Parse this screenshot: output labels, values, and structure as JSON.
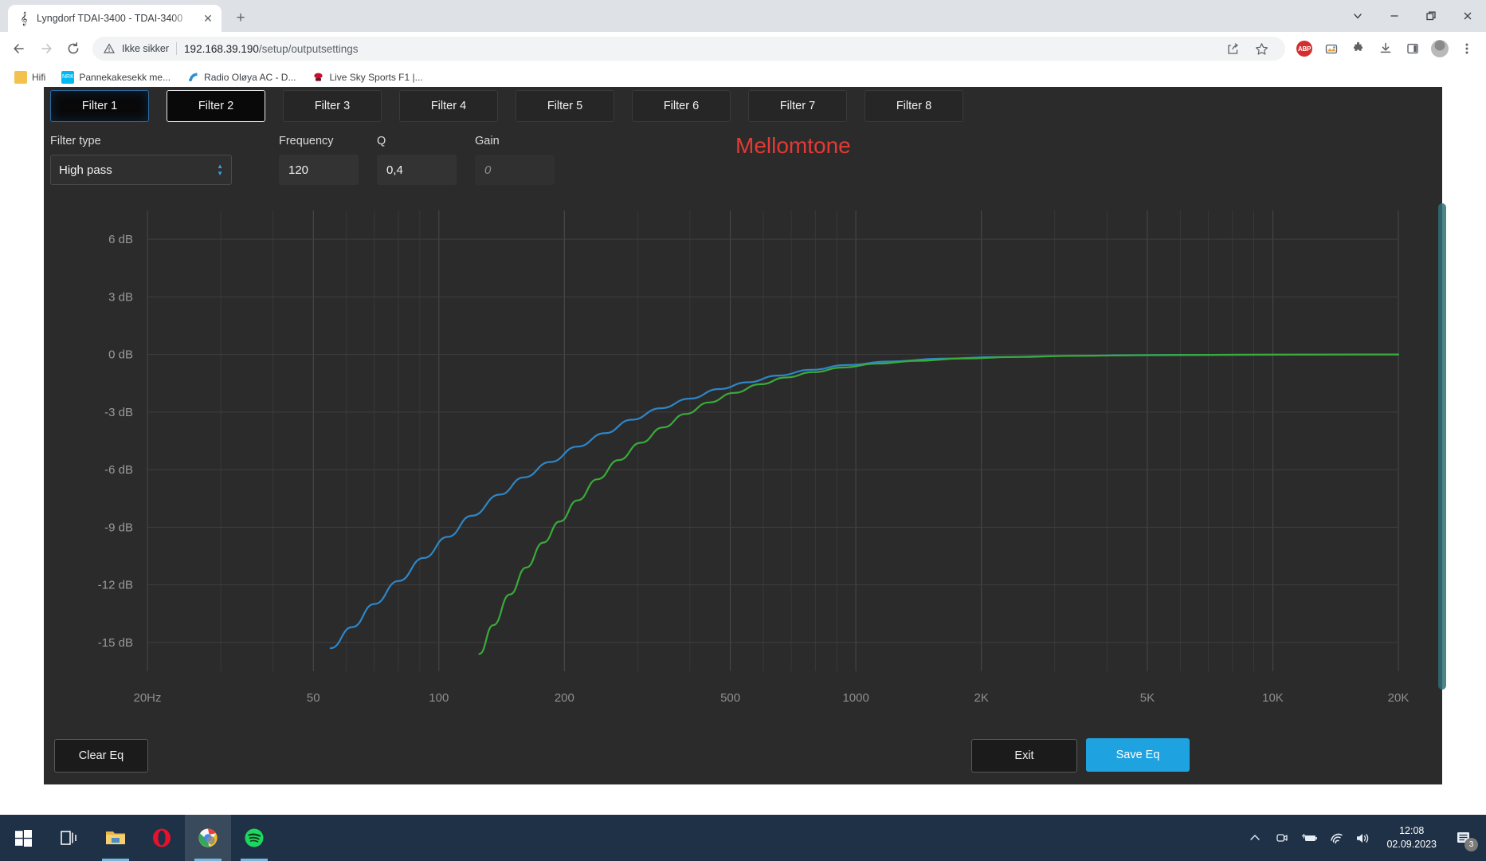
{
  "browser": {
    "tab": {
      "title": "Lyngdorf TDAI-3400 - TDAI-3400",
      "favicon": "music-note-icon",
      "close": "✕"
    },
    "newtab_label": "+",
    "window_controls": {
      "minimize_group": "∨",
      "minimize": "—",
      "restore": "restore-icon",
      "close": "✕"
    },
    "nav": {
      "back": "←",
      "forward": "→",
      "reload": "⟳"
    },
    "omnibox": {
      "warning_icon": "warning-triangle-icon",
      "security_text": "Ikke sikker",
      "host": "192.168.39.190",
      "path": "/setup/outputsettings",
      "share_icon": "share-icon",
      "bookmark_icon": "star-icon"
    },
    "extensions": {
      "adblock_label": "ABP",
      "gallery_icon": "photo-stack-icon",
      "puzzle_icon": "puzzle-icon",
      "download_icon": "download-icon",
      "sidepanel_icon": "side-panel-icon",
      "avatar_icon": "profile-avatar",
      "menu_icon": "three-dot-menu-icon"
    },
    "bookmarks": [
      {
        "label": "Hifi",
        "icon": "folder-icon",
        "color": "#f2c14e"
      },
      {
        "label": "Pannekakesekk me...",
        "icon": "nrk-icon",
        "color": "#00b9f2",
        "text": "NRK"
      },
      {
        "label": "Radio Oløya AC - D...",
        "icon": "rss-icon",
        "color": "#2d8fd5"
      },
      {
        "label": "Live Sky Sports F1 |...",
        "icon": "f1-icon",
        "color": "#c8102e"
      }
    ]
  },
  "app": {
    "filter_tabs": [
      {
        "label": "Filter 1",
        "state": "selected"
      },
      {
        "label": "Filter 2",
        "state": "focused"
      },
      {
        "label": "Filter 3",
        "state": "plain"
      },
      {
        "label": "Filter 4",
        "state": "plain"
      },
      {
        "label": "Filter 5",
        "state": "plain"
      },
      {
        "label": "Filter 6",
        "state": "plain"
      },
      {
        "label": "Filter 7",
        "state": "plain"
      },
      {
        "label": "Filter 8",
        "state": "plain"
      }
    ],
    "controls": {
      "filter_type_label": "Filter type",
      "filter_type_value": "High pass",
      "frequency_label": "Frequency",
      "frequency_value": "120",
      "q_label": "Q",
      "q_value": "0,4",
      "gain_label": "Gain",
      "gain_value": "",
      "gain_placeholder": "0"
    },
    "preset_name": "Mellomtone",
    "preset_color": "#e33a35",
    "buttons": {
      "clear_eq": "Clear Eq",
      "exit": "Exit",
      "save_eq": "Save Eq"
    }
  },
  "chart_data": {
    "type": "line",
    "title": "",
    "xlabel": "",
    "ylabel": "",
    "xscale": "log",
    "xlim": [
      20,
      20000
    ],
    "ylim": [
      -16.5,
      7.5
    ],
    "grid": true,
    "legend": "none",
    "xticks": [
      20,
      50,
      100,
      200,
      500,
      1000,
      2000,
      5000,
      10000,
      20000
    ],
    "xticklabels": [
      "20Hz",
      "50",
      "100",
      "200",
      "500",
      "1000",
      "2K",
      "5K",
      "10K",
      "20K"
    ],
    "yticks": [
      6,
      3,
      0,
      -3,
      -6,
      -9,
      -12,
      -15
    ],
    "yticklabels": [
      "6 dB",
      "3 dB",
      "0 dB",
      "-3 dB",
      "-6 dB",
      "-9 dB",
      "-12 dB",
      "-15 dB"
    ],
    "series": [
      {
        "name": "Filter 1 response",
        "color": "#2e86c8",
        "x": [
          55,
          62,
          70,
          80,
          92,
          105,
          120,
          140,
          160,
          185,
          215,
          250,
          290,
          340,
          400,
          470,
          550,
          650,
          780,
          950,
          1200,
          1600,
          2200,
          3200,
          5000,
          8000,
          13000,
          20000
        ],
        "y": [
          -15.3,
          -14.2,
          -13.0,
          -11.8,
          -10.6,
          -9.5,
          -8.4,
          -7.3,
          -6.4,
          -5.6,
          -4.8,
          -4.1,
          -3.4,
          -2.8,
          -2.3,
          -1.8,
          -1.45,
          -1.1,
          -0.8,
          -0.55,
          -0.37,
          -0.22,
          -0.13,
          -0.07,
          -0.03,
          -0.015,
          -0.005,
          0.0
        ]
      },
      {
        "name": "Filter 2 response",
        "color": "#3aab3a",
        "x": [
          125,
          135,
          148,
          162,
          178,
          195,
          215,
          240,
          270,
          305,
          345,
          390,
          445,
          510,
          590,
          680,
          790,
          930,
          1120,
          1400,
          1800,
          2400,
          3400,
          5200,
          8200,
          13000,
          20000
        ],
        "y": [
          -15.6,
          -14.1,
          -12.5,
          -11.1,
          -9.8,
          -8.7,
          -7.6,
          -6.5,
          -5.5,
          -4.6,
          -3.8,
          -3.1,
          -2.5,
          -2.0,
          -1.55,
          -1.2,
          -0.92,
          -0.68,
          -0.48,
          -0.33,
          -0.21,
          -0.13,
          -0.07,
          -0.035,
          -0.015,
          -0.006,
          0.0
        ]
      }
    ]
  },
  "taskbar": {
    "items": [
      {
        "name": "start-button",
        "icon": "windows-logo-icon"
      },
      {
        "name": "task-view-button",
        "icon": "task-view-icon"
      },
      {
        "name": "file-explorer-button",
        "icon": "folder-icon",
        "state": "open"
      },
      {
        "name": "opera-button",
        "icon": "opera-icon"
      },
      {
        "name": "chrome-button",
        "icon": "chrome-icon",
        "state": "active"
      },
      {
        "name": "spotify-button",
        "icon": "spotify-icon",
        "state": "open"
      }
    ],
    "tray": {
      "show_hidden": "chevron-up-icon",
      "meet_icon": "camera-icon",
      "battery_icon": "battery-charging-icon",
      "wifi_icon": "wifi-icon",
      "volume_icon": "speaker-icon",
      "time": "12:08",
      "date": "02.09.2023",
      "notifications_icon": "notification-icon",
      "notifications_count": "3"
    }
  }
}
